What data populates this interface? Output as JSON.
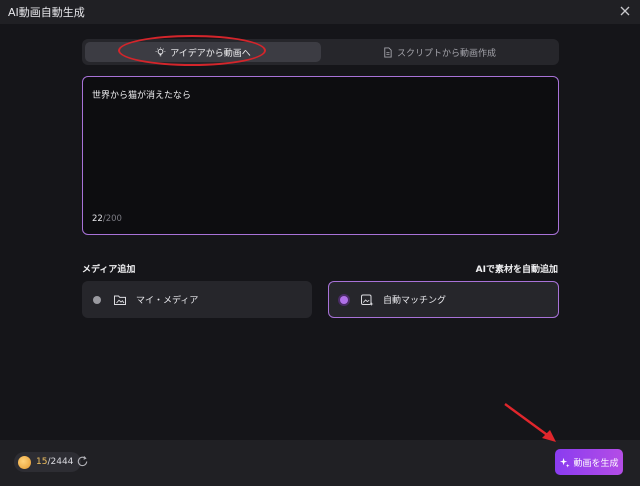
{
  "window": {
    "title": "AI動画自動生成"
  },
  "mode_tabs": [
    {
      "label": "アイデアから動画へ",
      "icon": "lightbulb-icon",
      "active": true
    },
    {
      "label": "スクリプトから動画作成",
      "icon": "script-document-icon",
      "active": false
    }
  ],
  "prompt": {
    "text": "世界から猫が消えたなら",
    "count": "22",
    "max": "/200"
  },
  "media": {
    "left_label": "メディア追加",
    "right_label": "AIで素材を自動追加",
    "options": [
      {
        "label": "マイ・メディア",
        "icon": "folder-media-icon",
        "selected": false
      },
      {
        "label": "自動マッチング",
        "icon": "image-sparkle-icon",
        "selected": true
      }
    ]
  },
  "footer": {
    "credits_used": "15",
    "credits_total": "/2444",
    "generate_label": "動画を生成"
  },
  "colors": {
    "accent": "#a872d8",
    "button": "#9a45ea",
    "annotation": "#d4252b"
  }
}
